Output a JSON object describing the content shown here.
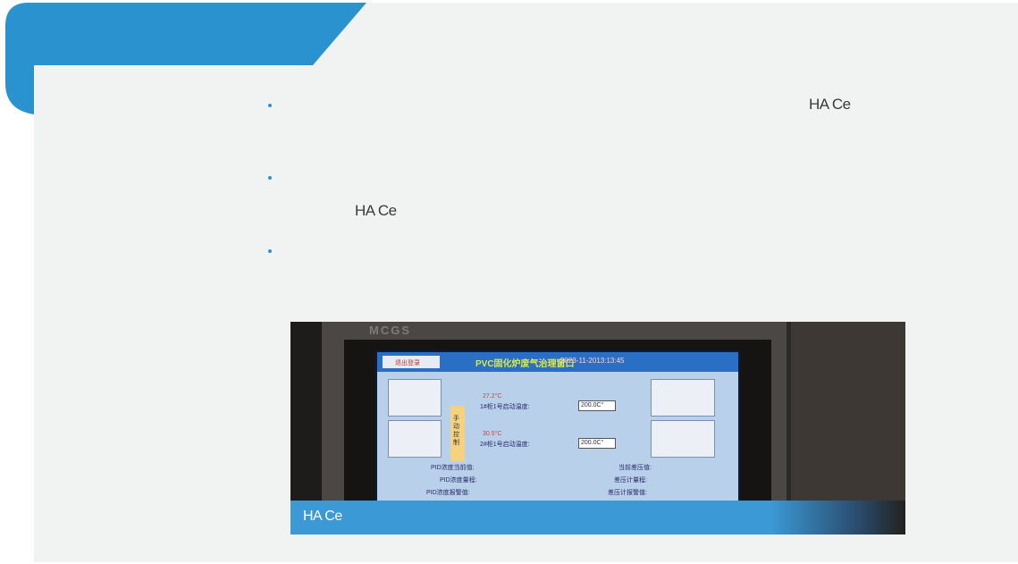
{
  "texts": {
    "label_1": "HA Ce",
    "label_2": "HA Ce",
    "caption": "HA Ce"
  },
  "photo": {
    "brand": "MCGS",
    "screen_title": "PVC固化炉废气治理窗口",
    "screen_datetime": "2023-11-2013:13:45",
    "exit_button": "退出登录",
    "temp_1": "27.2°C",
    "temp_2": "30.5°C",
    "setting_1": "1#柜1号启动温度:",
    "setting_2": "2#柜1号启动温度:",
    "value_1": "200.0C°",
    "value_2": "200.0C°",
    "manual_control": "手动控制",
    "pid_current": "PID浓度当前值:",
    "pid_range": "PID浓度量程:",
    "pid_alarm": "PID浓度报警值:",
    "pressure_current": "当前差压值:",
    "pressure_range": "差压计量程:",
    "pressure_alarm": "差压计报警值:"
  },
  "colors": {
    "accent": "#2a93cf",
    "panel": "#f1f3f3",
    "caption_bar": "#3b9ad6"
  }
}
